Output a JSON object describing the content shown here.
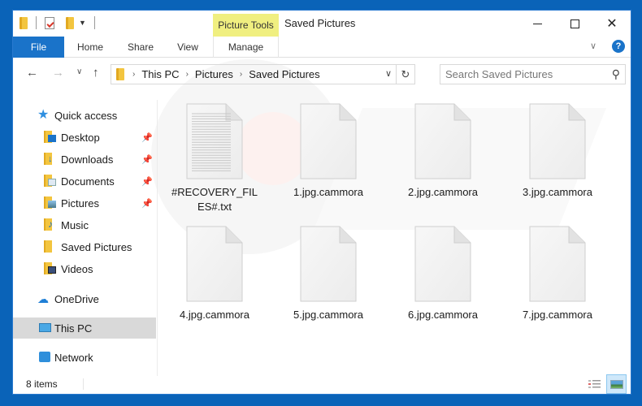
{
  "window": {
    "title": "Saved Pictures",
    "contextual_tab_group": "Picture Tools",
    "controls": {
      "minimize": "Minimize",
      "maximize": "Maximize",
      "close": "Close"
    }
  },
  "quick_access_toolbar": {
    "items": [
      "folder-icon",
      "properties-icon",
      "new-folder-icon",
      "customize-dropdown"
    ]
  },
  "ribbon": {
    "tabs": [
      {
        "label": "File",
        "active": true
      },
      {
        "label": "Home"
      },
      {
        "label": "Share"
      },
      {
        "label": "View"
      },
      {
        "label": "Manage"
      }
    ],
    "help": "?",
    "collapse_glyph": "∨"
  },
  "navigation": {
    "back": "←",
    "forward": "→",
    "recent": "⌄",
    "up": "↑",
    "breadcrumb": [
      "This PC",
      "Pictures",
      "Saved Pictures"
    ],
    "crumb_separator": "›",
    "refresh": "↻",
    "dropdown": "⌄"
  },
  "search": {
    "placeholder": "Search Saved Pictures",
    "value": ""
  },
  "nav_pane": {
    "quick_access": "Quick access",
    "quick_items": [
      {
        "label": "Desktop",
        "pinned": true,
        "icon": "desktop-folder-icon"
      },
      {
        "label": "Downloads",
        "pinned": true,
        "icon": "downloads-folder-icon"
      },
      {
        "label": "Documents",
        "pinned": true,
        "icon": "documents-folder-icon"
      },
      {
        "label": "Pictures",
        "pinned": true,
        "icon": "pictures-folder-icon"
      },
      {
        "label": "Music",
        "pinned": false,
        "icon": "music-folder-icon"
      },
      {
        "label": "Saved Pictures",
        "pinned": false,
        "icon": "folder-icon"
      },
      {
        "label": "Videos",
        "pinned": false,
        "icon": "videos-folder-icon"
      }
    ],
    "onedrive": "OneDrive",
    "this_pc": "This PC",
    "network": "Network",
    "selected": "This PC"
  },
  "files": [
    {
      "name": "#RECOVERY_FILES#.txt",
      "type": "text"
    },
    {
      "name": "1.jpg.cammora",
      "type": "blank"
    },
    {
      "name": "2.jpg.cammora",
      "type": "blank"
    },
    {
      "name": "3.jpg.cammora",
      "type": "blank"
    },
    {
      "name": "4.jpg.cammora",
      "type": "blank"
    },
    {
      "name": "5.jpg.cammora",
      "type": "blank"
    },
    {
      "name": "6.jpg.cammora",
      "type": "blank"
    },
    {
      "name": "7.jpg.cammora",
      "type": "blank"
    }
  ],
  "status": {
    "item_count": "8 items",
    "view_mode": "large-icons"
  },
  "colors": {
    "accent": "#1a73c9",
    "desktop_bg": "#0a63b8",
    "contextual_tab": "#f0ef80",
    "selected_nav": "#d9d9d9"
  }
}
